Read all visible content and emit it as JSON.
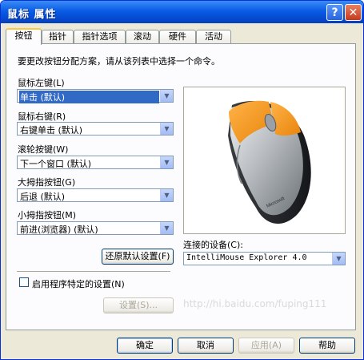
{
  "window": {
    "title": "鼠标 属性"
  },
  "titlebar_buttons": {
    "help": "?",
    "close": "✕"
  },
  "tabs": [
    "按钮",
    "指针",
    "指针选项",
    "滚动",
    "硬件",
    "活动"
  ],
  "instruction": "要更改按钮分配方案，请从该列表中选择一个命令。",
  "left_button": {
    "label": "鼠标左键(L)",
    "value": "单击 (默认)"
  },
  "right_button": {
    "label": "鼠标右键(R)",
    "value": "右键单击 (默认)"
  },
  "wheel_button": {
    "label": "滚轮按键(W)",
    "value": "下一个窗口 (默认)"
  },
  "thumb_big": {
    "label": "大拇指按钮(G)",
    "value": "后退 (默认)"
  },
  "thumb_small": {
    "label": "小拇指按钮(M)",
    "value": "前进(浏览器) (默认)"
  },
  "restore_defaults": "还原默认设置(F)",
  "device": {
    "label": "连接的设备(C):",
    "value": "IntelliMouse Explorer 4.0"
  },
  "app_specific": {
    "label": "启用程序特定的设置(N)",
    "checked": false
  },
  "settings_button": "设置(S)...",
  "watermark": "http://hi.baidu.com/fuping111",
  "footer": {
    "ok": "确定",
    "cancel": "取消",
    "apply": "应用(A)",
    "help": "帮助"
  },
  "mouse_image": {
    "brand": "Microsoft",
    "accent_color": "#f7941d",
    "body_color": "#b8bcc0"
  }
}
